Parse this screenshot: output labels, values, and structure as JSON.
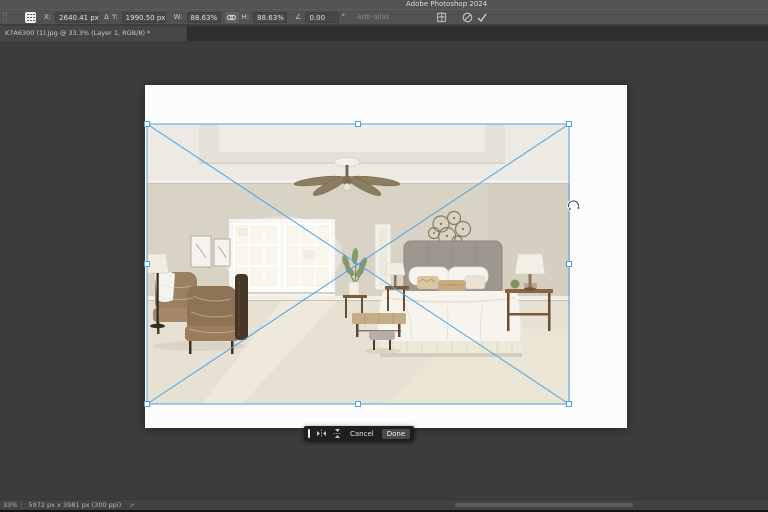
{
  "app": {
    "title": "Adobe Photoshop 2024"
  },
  "options_bar": {
    "x_label": "X:",
    "x_value": "2640.41 px",
    "delta_glyph": "Δ",
    "y_label": "Y:",
    "y_value": "1990.50 px",
    "w_label": "W:",
    "w_value": "88.63%",
    "h_label": "H:",
    "h_value": "88.63%",
    "angle_glyph": "∠",
    "angle_value": "0.00",
    "angle_unit": "°",
    "interpolation_label": "Anti-alias"
  },
  "tabs": [
    {
      "label": "K7A6300 (1).jpg @ 33.3% (Layer 1, RGB/8) *",
      "active": true
    }
  ],
  "canvas": {
    "content_description": "staged bedroom photo being scaled with Free Transform"
  },
  "task_bar": {
    "cancel_label": "Cancel",
    "done_label": "Done"
  },
  "status_bar": {
    "zoom_level": "33%",
    "document_info": "5972 px x 3981 px (300 ppi)",
    "expand_glyph": ">"
  },
  "icons": {
    "reference_point": "reference-point-grid",
    "relative_positioning": "delta-triangle",
    "link": "maintain-aspect-ratio-chain",
    "warp": "warp-mode-toggle",
    "cancel_transform": "circle-slash",
    "commit_transform": "checkmark",
    "flip_horizontal": "mirror-horizontal",
    "flip_vertical": "mirror-vertical",
    "rotate_cursor": "curved-rotate-arrow"
  },
  "colors": {
    "transform_accent": "#4da3e8",
    "titlebar_bg": "#535353",
    "pasteboard_bg": "#3c3c3c",
    "canvas_bg": "#fcfcfc",
    "taskbar_bg": "#1f1f1f"
  }
}
